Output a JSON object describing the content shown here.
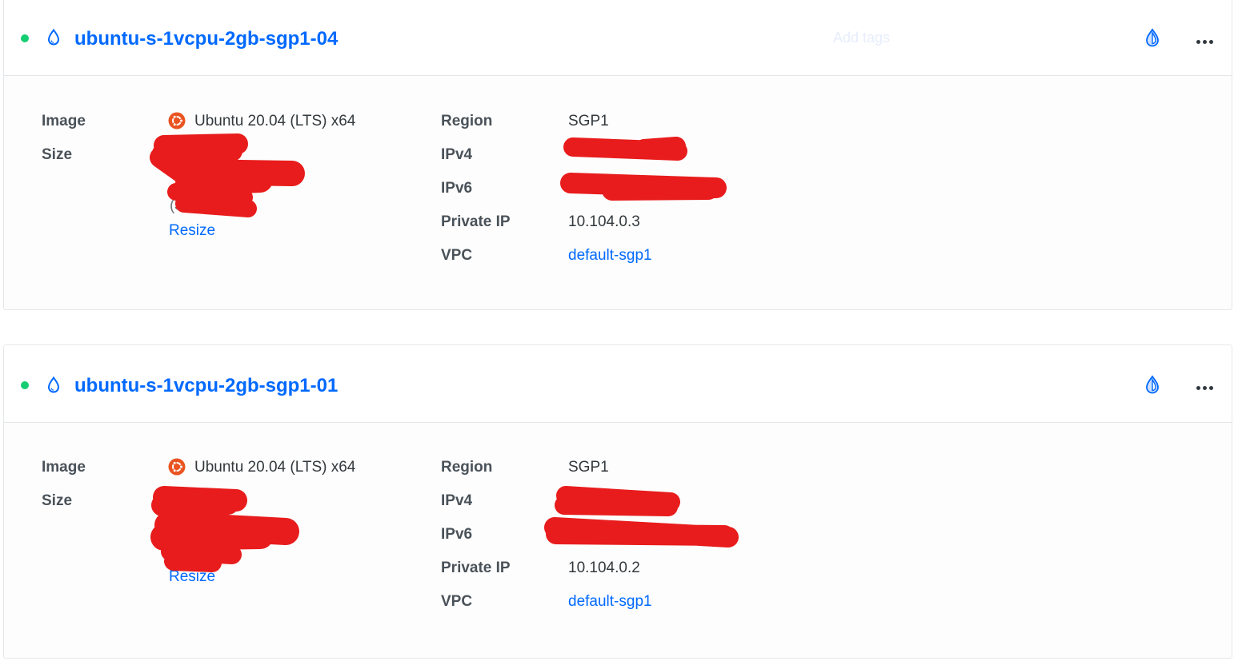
{
  "colors": {
    "accent": "#0069ff",
    "status_active": "#15cd72",
    "ubuntu": "#e95420",
    "redaction": "#e81c1c"
  },
  "droplets": [
    {
      "name": "ubuntu-s-1vcpu-2gb-sgp1-04",
      "status": "active",
      "add_tags": "Add tags",
      "icons": [
        "status-dot",
        "droplet-icon",
        "monitoring-icon",
        "more-options-icon"
      ],
      "details": {
        "image_label": "Image",
        "image_value": "Ubuntu 20.04 (LTS) x64",
        "image_icon": "ubuntu-logo-icon",
        "size_label": "Size",
        "size_value_partial": "($",
        "resize_label": "Resize",
        "region_label": "Region",
        "region_value": "SGP1",
        "ipv4_label": "IPv4",
        "ipv6_label": "IPv6",
        "private_ip_label": "Private IP",
        "private_ip_value": "10.104.0.3",
        "vpc_label": "VPC",
        "vpc_value": "default-sgp1"
      }
    },
    {
      "name": "ubuntu-s-1vcpu-2gb-sgp1-01",
      "status": "active",
      "icons": [
        "status-dot",
        "droplet-icon",
        "monitoring-icon",
        "more-options-icon"
      ],
      "details": {
        "image_label": "Image",
        "image_value": "Ubuntu 20.04 (LTS) x64",
        "image_icon": "ubuntu-logo-icon",
        "size_label": "Size",
        "resize_label": "Resize",
        "region_label": "Region",
        "region_value": "SGP1",
        "ipv4_label": "IPv4",
        "ipv6_label": "IPv6",
        "private_ip_label": "Private IP",
        "private_ip_value": "10.104.0.2",
        "vpc_label": "VPC",
        "vpc_value": "default-sgp1"
      }
    }
  ]
}
